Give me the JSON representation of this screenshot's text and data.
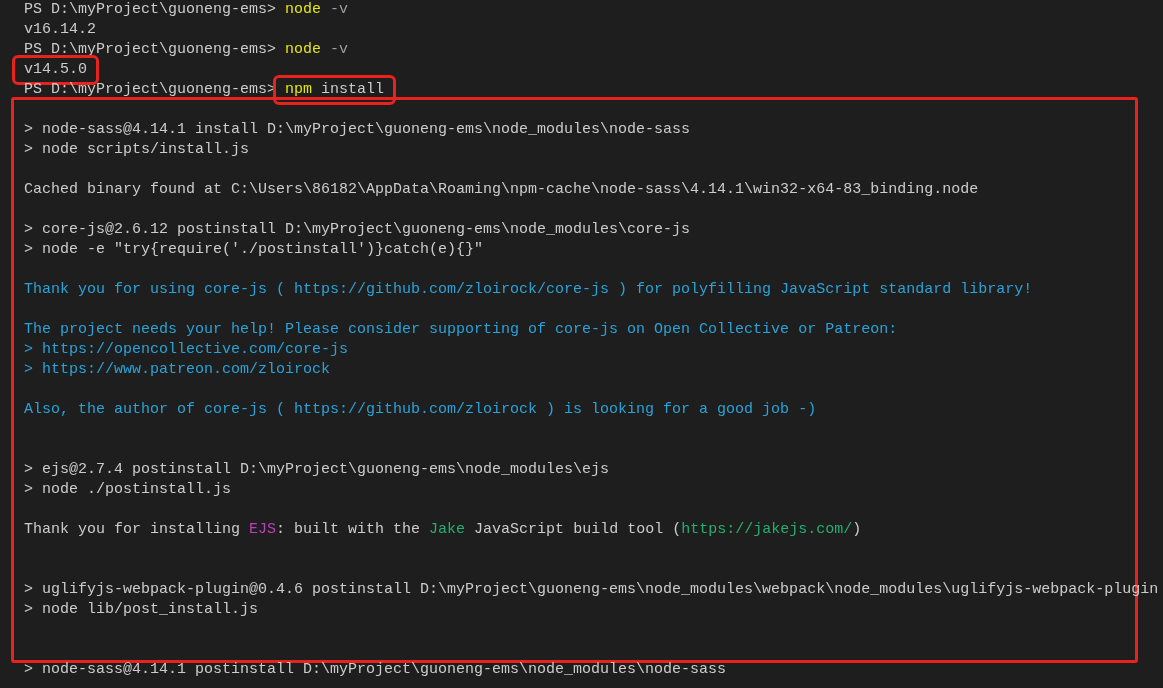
{
  "blocks": [
    {
      "boxed": false,
      "lines": [
        {
          "kind": "text",
          "segments": [
            {
              "text": "PS D:\\myProject\\guoneng-ems> "
            },
            {
              "text": "node",
              "color": "#e5e510"
            },
            {
              "text": " -v",
              "color": "#9d9d9d"
            }
          ]
        },
        {
          "kind": "text",
          "segments": [
            {
              "text": "v16.14.2"
            }
          ]
        },
        {
          "kind": "text",
          "segments": [
            {
              "text": "PS D:\\myProject\\guoneng-ems> "
            },
            {
              "text": "node",
              "color": "#e5e510"
            },
            {
              "text": " -v",
              "color": "#9d9d9d"
            }
          ]
        },
        {
          "kind": "text",
          "segments": [
            {
              "text": "v14.5.0",
              "boxed": true
            }
          ]
        },
        {
          "kind": "text",
          "segments": [
            {
              "text": "PS D:\\myProject\\guoneng-ems> "
            },
            {
              "text": "npm",
              "color": "#e5e510",
              "boxed": true
            },
            {
              "text": " install",
              "boxed": true
            }
          ]
        }
      ]
    },
    {
      "boxed": true,
      "lines": [
        {
          "kind": "blank"
        },
        {
          "kind": "text",
          "segments": [
            {
              "text": "> node-sass@4.14.1 install D:\\myProject\\guoneng-ems\\node_modules\\node-sass"
            }
          ]
        },
        {
          "kind": "text",
          "segments": [
            {
              "text": "> node scripts/install.js"
            }
          ]
        },
        {
          "kind": "blank"
        },
        {
          "kind": "text",
          "segments": [
            {
              "text": "Cached binary found at C:\\Users\\86182\\AppData\\Roaming\\npm-cache\\node-sass\\4.14.1\\win32-x64-83_binding.node"
            }
          ]
        },
        {
          "kind": "blank"
        },
        {
          "kind": "text",
          "segments": [
            {
              "text": "> core-js@2.6.12 postinstall D:\\myProject\\guoneng-ems\\node_modules\\core-js"
            }
          ]
        },
        {
          "kind": "text",
          "segments": [
            {
              "text": "> node -e \"try{require('./postinstall')}catch(e){}\""
            }
          ]
        },
        {
          "kind": "blank"
        },
        {
          "kind": "text",
          "segments": [
            {
              "text": "Thank you for using core-js ( https://github.com/zloirock/core-js ) for polyfilling JavaScript standard library!",
              "color": "#29a3d8"
            }
          ]
        },
        {
          "kind": "blank"
        },
        {
          "kind": "text",
          "segments": [
            {
              "text": "The project needs your help! Please consider supporting of core-js on Open Collective or Patreon:",
              "color": "#29a3d8"
            }
          ]
        },
        {
          "kind": "text",
          "segments": [
            {
              "text": "> https://opencollective.com/core-js",
              "color": "#29a3d8"
            }
          ]
        },
        {
          "kind": "text",
          "segments": [
            {
              "text": "> https://www.patreon.com/zloirock",
              "color": "#29a3d8"
            }
          ]
        },
        {
          "kind": "blank"
        },
        {
          "kind": "text",
          "segments": [
            {
              "text": "Also, the author of core-js ( https://github.com/zloirock ) is looking for a good job -)",
              "color": "#29a3d8"
            }
          ]
        },
        {
          "kind": "blank"
        },
        {
          "kind": "blank"
        },
        {
          "kind": "text",
          "segments": [
            {
              "text": "> ejs@2.7.4 postinstall D:\\myProject\\guoneng-ems\\node_modules\\ejs"
            }
          ]
        },
        {
          "kind": "text",
          "segments": [
            {
              "text": "> node ./postinstall.js"
            }
          ]
        },
        {
          "kind": "blank"
        },
        {
          "kind": "text",
          "segments": [
            {
              "text": "Thank you for installing "
            },
            {
              "text": "EJS",
              "color": "#bc3fbc"
            },
            {
              "text": ": built with the "
            },
            {
              "text": "Jake",
              "color": "#23b070"
            },
            {
              "text": " JavaScript build tool ("
            },
            {
              "text": "https://jakejs.com/",
              "color": "#23b070"
            },
            {
              "text": ")"
            }
          ]
        },
        {
          "kind": "blank"
        },
        {
          "kind": "blank"
        },
        {
          "kind": "text",
          "segments": [
            {
              "text": "> uglifyjs-webpack-plugin@0.4.6 postinstall D:\\myProject\\guoneng-ems\\node_modules\\webpack\\node_modules\\uglifyjs-webpack-plugin"
            }
          ]
        },
        {
          "kind": "text",
          "segments": [
            {
              "text": "> node lib/post_install.js"
            }
          ]
        },
        {
          "kind": "blank"
        },
        {
          "kind": "blank"
        }
      ]
    },
    {
      "boxed": false,
      "lines": [
        {
          "kind": "text",
          "segments": [
            {
              "text": "> node-sass@4.14.1 postinstall D:\\myProject\\guoneng-ems\\node_modules\\node-sass"
            }
          ]
        }
      ]
    }
  ]
}
